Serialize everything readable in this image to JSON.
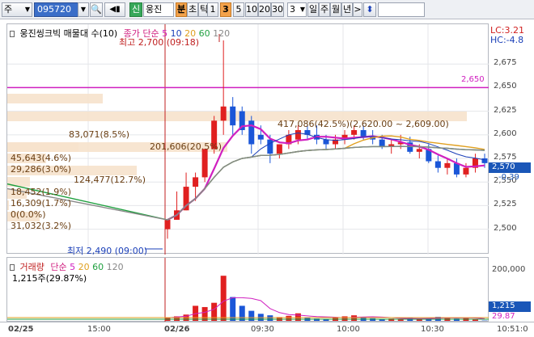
{
  "toolbar": {
    "market": "주",
    "code": "095720",
    "new_label": "신",
    "stock_name": "웅진",
    "period_label": "분",
    "tick_label": "초",
    "tick2_label": "틱",
    "intervals": [
      "1",
      "3",
      "5",
      "10",
      "20",
      "30"
    ],
    "active_interval": "3",
    "count_value": "3",
    "day_label": "일",
    "week_label": "주",
    "month_label": "월",
    "year_label": "년",
    "next_label": ">"
  },
  "price_panel": {
    "title": "웅진씽크빅 매물대 수(10)",
    "ma_prefix": "종가 단순",
    "ma_periods": [
      "5",
      "10",
      "20",
      "60",
      "120"
    ],
    "ma_colors": [
      "#d020c0",
      "#1a3fb8",
      "#e0a020",
      "#20a040",
      "#888888"
    ],
    "high_label": "최고 2,700 (09:18)",
    "low_label": "최저 2,490 (09:00)",
    "lc_label": "LC:3.21",
    "hc_label": "HC:-4.8",
    "ref_price_label": "2,650",
    "current_price": "2,570",
    "change_pct": "-0.39",
    "y_ticks": [
      "2,675",
      "2,650",
      "2,625",
      "2,600",
      "2,575",
      "2,550",
      "2,525",
      "2,500"
    ],
    "volume_profile": [
      {
        "text": "417,086(42.5%)(2,620.00 ~ 2,609.00)"
      },
      {
        "text": "83,071(8.5%)"
      },
      {
        "text": "201,606(20.5%)"
      },
      {
        "text": "45,643(4.6%)"
      },
      {
        "text": "29,286(3.0%)"
      },
      {
        "text": "124,477(12.7%)"
      },
      {
        "text": "18,452(1.9%)"
      },
      {
        "text": "16,309(1.7%)"
      },
      {
        "text": "0(0.0%)"
      },
      {
        "text": "31,032(3.2%)"
      }
    ]
  },
  "volume_panel": {
    "title": "거래량",
    "ma_prefix": "단순",
    "ma_periods": [
      "5",
      "20",
      "60",
      "120"
    ],
    "value_label": "1,215주(29.87%)",
    "y_tick": "200,000",
    "current_value": "1,215",
    "pct_label": "29.87"
  },
  "time_axis": [
    "02/25",
    "15:00",
    "02/26",
    "09:30",
    "10:00",
    "10:30",
    "10:51:0"
  ],
  "chart_data": {
    "type": "candlestick",
    "ylim": [
      2480,
      2700
    ],
    "reference_line": 2650,
    "candles": [
      {
        "t": "09:00",
        "o": 2500,
        "h": 2510,
        "l": 2490,
        "c": 2510
      },
      {
        "t": "09:03",
        "o": 2510,
        "h": 2540,
        "l": 2510,
        "c": 2520
      },
      {
        "t": "09:06",
        "o": 2520,
        "h": 2560,
        "l": 2520,
        "c": 2545
      },
      {
        "t": "09:09",
        "o": 2545,
        "h": 2560,
        "l": 2530,
        "c": 2555
      },
      {
        "t": "09:12",
        "o": 2555,
        "h": 2585,
        "l": 2550,
        "c": 2585
      },
      {
        "t": "09:15",
        "o": 2585,
        "h": 2620,
        "l": 2580,
        "c": 2615
      },
      {
        "t": "09:18",
        "o": 2615,
        "h": 2700,
        "l": 2600,
        "c": 2630
      },
      {
        "t": "09:21",
        "o": 2630,
        "h": 2640,
        "l": 2600,
        "c": 2610
      },
      {
        "t": "09:24",
        "o": 2625,
        "h": 2630,
        "l": 2600,
        "c": 2605
      },
      {
        "t": "09:27",
        "o": 2615,
        "h": 2620,
        "l": 2580,
        "c": 2590
      },
      {
        "t": "09:30",
        "o": 2600,
        "h": 2610,
        "l": 2590,
        "c": 2595
      },
      {
        "t": "09:33",
        "o": 2595,
        "h": 2600,
        "l": 2570,
        "c": 2580
      },
      {
        "t": "09:36",
        "o": 2580,
        "h": 2590,
        "l": 2575,
        "c": 2590
      },
      {
        "t": "09:39",
        "o": 2590,
        "h": 2605,
        "l": 2585,
        "c": 2600
      },
      {
        "t": "09:42",
        "o": 2595,
        "h": 2610,
        "l": 2590,
        "c": 2605
      },
      {
        "t": "09:45",
        "o": 2605,
        "h": 2610,
        "l": 2595,
        "c": 2600
      },
      {
        "t": "09:48",
        "o": 2600,
        "h": 2610,
        "l": 2590,
        "c": 2595
      },
      {
        "t": "09:51",
        "o": 2595,
        "h": 2600,
        "l": 2585,
        "c": 2590
      },
      {
        "t": "09:54",
        "o": 2590,
        "h": 2600,
        "l": 2585,
        "c": 2595
      },
      {
        "t": "09:57",
        "o": 2595,
        "h": 2605,
        "l": 2590,
        "c": 2600
      },
      {
        "t": "10:00",
        "o": 2600,
        "h": 2610,
        "l": 2595,
        "c": 2605
      },
      {
        "t": "10:03",
        "o": 2605,
        "h": 2610,
        "l": 2595,
        "c": 2598
      },
      {
        "t": "10:06",
        "o": 2598,
        "h": 2605,
        "l": 2590,
        "c": 2595
      },
      {
        "t": "10:09",
        "o": 2595,
        "h": 2600,
        "l": 2585,
        "c": 2588
      },
      {
        "t": "10:12",
        "o": 2588,
        "h": 2595,
        "l": 2580,
        "c": 2590
      },
      {
        "t": "10:15",
        "o": 2590,
        "h": 2600,
        "l": 2585,
        "c": 2592
      },
      {
        "t": "10:18",
        "o": 2592,
        "h": 2598,
        "l": 2580,
        "c": 2582
      },
      {
        "t": "10:21",
        "o": 2582,
        "h": 2590,
        "l": 2575,
        "c": 2585
      },
      {
        "t": "10:24",
        "o": 2585,
        "h": 2590,
        "l": 2570,
        "c": 2572
      },
      {
        "t": "10:27",
        "o": 2572,
        "h": 2578,
        "l": 2560,
        "c": 2565
      },
      {
        "t": "10:30",
        "o": 2565,
        "h": 2575,
        "l": 2558,
        "c": 2570
      },
      {
        "t": "10:33",
        "o": 2570,
        "h": 2575,
        "l": 2555,
        "c": 2558
      },
      {
        "t": "10:36",
        "o": 2558,
        "h": 2570,
        "l": 2555,
        "c": 2565
      },
      {
        "t": "10:39",
        "o": 2565,
        "h": 2580,
        "l": 2560,
        "c": 2575
      },
      {
        "t": "10:42",
        "o": 2575,
        "h": 2580,
        "l": 2565,
        "c": 2570
      }
    ],
    "volumes": [
      12000,
      18000,
      25000,
      60000,
      55000,
      72000,
      180000,
      95000,
      60000,
      40000,
      28000,
      22000,
      15000,
      20000,
      30000,
      12000,
      9000,
      8000,
      14000,
      18000,
      22000,
      16000,
      10000,
      8000,
      9000,
      7000,
      12000,
      8000,
      10000,
      16000,
      14000,
      9000,
      11000,
      6000,
      1215
    ]
  }
}
